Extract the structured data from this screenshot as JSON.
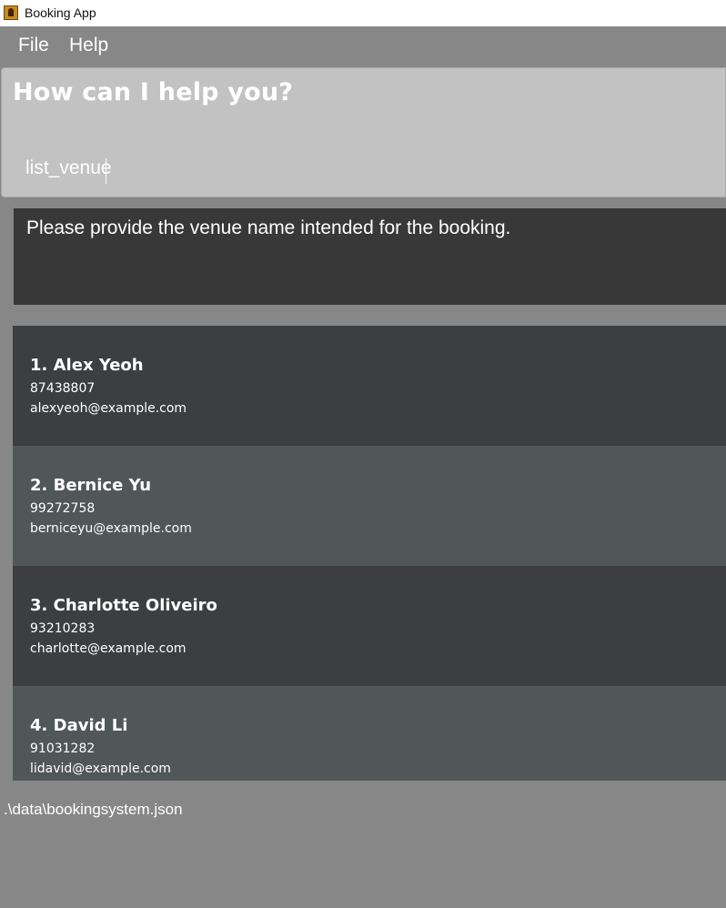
{
  "window": {
    "title": "Booking App",
    "icon": "app-icon"
  },
  "menu": {
    "file": "File",
    "help": "Help"
  },
  "command": {
    "heading": "How can I help you?",
    "input_value": "list_venue"
  },
  "result": {
    "message": "Please provide the venue name intended for the booking."
  },
  "persons": [
    {
      "name": "1.  Alex Yeoh",
      "phone": "87438807",
      "email": "alexyeoh@example.com"
    },
    {
      "name": "2.  Bernice Yu",
      "phone": "99272758",
      "email": "berniceyu@example.com"
    },
    {
      "name": "3.  Charlotte Oliveiro",
      "phone": "93210283",
      "email": "charlotte@example.com"
    },
    {
      "name": "4.  David Li",
      "phone": "91031282",
      "email": "lidavid@example.com"
    }
  ],
  "status": {
    "file_path": ".\\data\\bookingsystem.json"
  },
  "colors": {
    "background": "#878787",
    "command_box": "#c2c2c2",
    "result_box": "#383838",
    "card_dark": "#3c3e3f",
    "card_light": "#515658"
  }
}
